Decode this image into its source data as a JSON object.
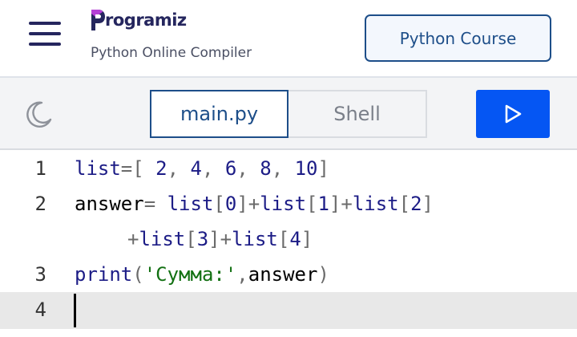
{
  "header": {
    "logo_text": "rogramiz",
    "logo_letter": "P",
    "subtitle": "Python Online Compiler",
    "course_button": "Python Course"
  },
  "toolbar": {
    "tabs": [
      {
        "label": "main.py",
        "active": true
      },
      {
        "label": "Shell",
        "active": false
      }
    ],
    "theme_icon": "moon-icon",
    "run_icon": "play-icon"
  },
  "editor": {
    "lines": [
      {
        "number": "1",
        "tokens": [
          {
            "t": "list",
            "c": "fn"
          },
          {
            "t": "=[ ",
            "c": "op"
          },
          {
            "t": "2",
            "c": "num"
          },
          {
            "t": ", ",
            "c": "op"
          },
          {
            "t": "4",
            "c": "num"
          },
          {
            "t": ", ",
            "c": "op"
          },
          {
            "t": "6",
            "c": "num"
          },
          {
            "t": ", ",
            "c": "op"
          },
          {
            "t": "8",
            "c": "num"
          },
          {
            "t": ", ",
            "c": "op"
          },
          {
            "t": "10",
            "c": "num"
          },
          {
            "t": "]",
            "c": "op"
          }
        ]
      },
      {
        "number": "2",
        "tokens": [
          {
            "t": "answer",
            "c": ""
          },
          {
            "t": "= ",
            "c": "op"
          },
          {
            "t": "list",
            "c": "fn"
          },
          {
            "t": "[",
            "c": "op"
          },
          {
            "t": "0",
            "c": "num"
          },
          {
            "t": "]",
            "c": "op"
          },
          {
            "t": "+",
            "c": "op"
          },
          {
            "t": "list",
            "c": "fn"
          },
          {
            "t": "[",
            "c": "op"
          },
          {
            "t": "1",
            "c": "num"
          },
          {
            "t": "]",
            "c": "op"
          },
          {
            "t": "+",
            "c": "op"
          },
          {
            "t": "list",
            "c": "fn"
          },
          {
            "t": "[",
            "c": "op"
          },
          {
            "t": "2",
            "c": "num"
          },
          {
            "t": "]",
            "c": "op"
          }
        ]
      },
      {
        "number": "",
        "tokens": [
          {
            "t": "+",
            "c": "op"
          },
          {
            "t": "list",
            "c": "fn"
          },
          {
            "t": "[",
            "c": "op"
          },
          {
            "t": "3",
            "c": "num"
          },
          {
            "t": "]",
            "c": "op"
          },
          {
            "t": "+",
            "c": "op"
          },
          {
            "t": "list",
            "c": "fn"
          },
          {
            "t": "[",
            "c": "op"
          },
          {
            "t": "4",
            "c": "num"
          },
          {
            "t": "]",
            "c": "op"
          }
        ]
      },
      {
        "number": "3",
        "tokens": [
          {
            "t": "print",
            "c": "fn"
          },
          {
            "t": "(",
            "c": "op"
          },
          {
            "t": "'Сумма:'",
            "c": "str"
          },
          {
            "t": ",",
            "c": "op"
          },
          {
            "t": "answer",
            "c": ""
          },
          {
            "t": ")",
            "c": "op"
          }
        ]
      },
      {
        "number": "4",
        "tokens": []
      }
    ]
  },
  "colors": {
    "brand_navy": "#25265e",
    "accent_blue": "#0556f3",
    "tab_border": "#1d4e89",
    "string_green": "#127012",
    "keyword_blue": "#1c1c86"
  }
}
